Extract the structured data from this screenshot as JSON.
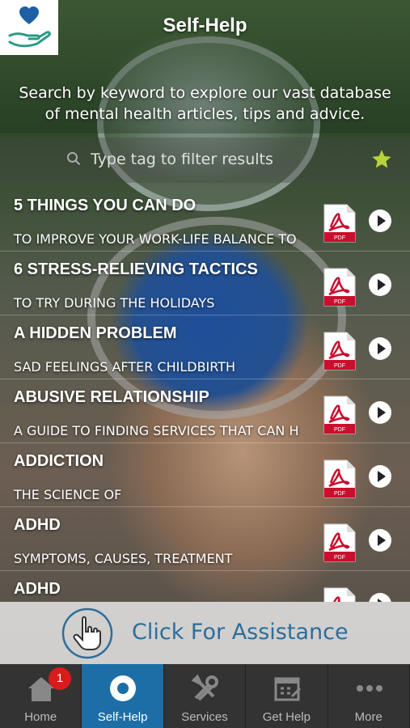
{
  "header": {
    "title": "Self-Help",
    "description_line1": "Search by keyword to explore our vast database",
    "description_line2": "of mental health articles, tips and advice."
  },
  "search": {
    "placeholder": "Type tag to filter results",
    "value": ""
  },
  "articles": [
    {
      "title": "5 THINGS YOU CAN DO",
      "subtitle": "TO IMPROVE YOUR WORK-LIFE BALANCE TO"
    },
    {
      "title": "6 STRESS-RELIEVING TACTICS",
      "subtitle": "TO TRY DURING THE HOLIDAYS"
    },
    {
      "title": "A HIDDEN PROBLEM",
      "subtitle": "SAD FEELINGS AFTER CHILDBIRTH"
    },
    {
      "title": "ABUSIVE RELATIONSHIP",
      "subtitle": "A GUIDE TO FINDING SERVICES THAT CAN H"
    },
    {
      "title": "ADDICTION",
      "subtitle": "THE SCIENCE OF"
    },
    {
      "title": "ADHD",
      "subtitle": "SYMPTOMS, CAUSES, TREATMENT"
    },
    {
      "title": "ADHD",
      "subtitle": ""
    }
  ],
  "assist": {
    "label": "Click For Assistance"
  },
  "tabs": [
    {
      "label": "Home",
      "icon": "home-icon",
      "badge": "1"
    },
    {
      "label": "Self-Help",
      "icon": "self-help-icon"
    },
    {
      "label": "Services",
      "icon": "tools-icon"
    },
    {
      "label": "Get Help",
      "icon": "calendar-icon"
    },
    {
      "label": "More",
      "icon": "more-dots-icon"
    }
  ],
  "colors": {
    "accent": "#1d6ea6",
    "assist_text": "#2e6d99",
    "badge": "#d81b1b",
    "pdf_red": "#c8102e",
    "star": "#b7d33a"
  }
}
